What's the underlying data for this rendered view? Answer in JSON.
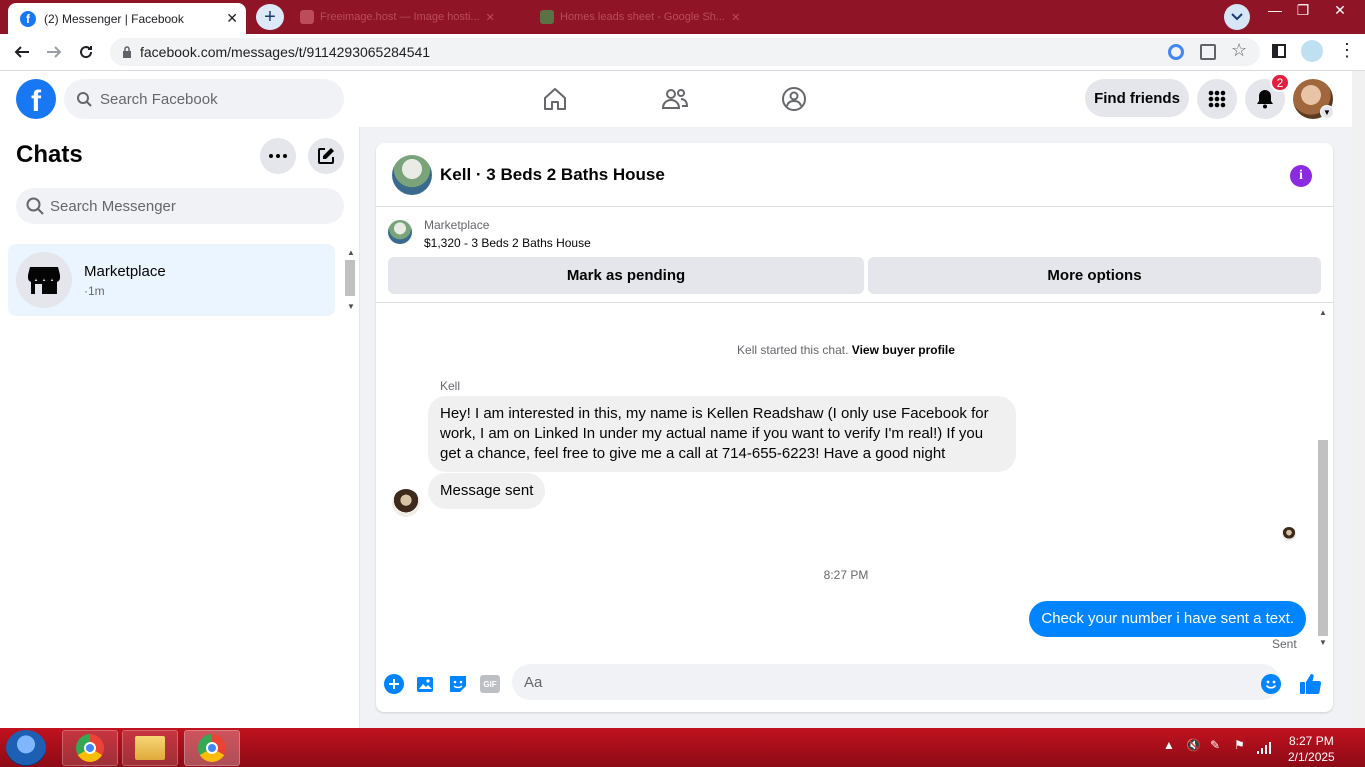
{
  "browser": {
    "active_tab_title": "(2) Messenger | Facebook",
    "inactive_tabs": [
      "Freeimage.host — Image hosti...",
      "Homes leads sheet - Google Sh..."
    ],
    "url": "facebook.com/messages/t/9114293065284541"
  },
  "fb_header": {
    "logo": "f",
    "search_placeholder": "Search Facebook",
    "find_friends": "Find friends",
    "notification_count": "2"
  },
  "chats": {
    "title": "Chats",
    "search_placeholder": "Search Messenger",
    "items": [
      {
        "name": "Marketplace",
        "time": "·1m"
      }
    ]
  },
  "conversation": {
    "title": "Kell · 3 Beds 2 Baths House",
    "info_glyph": "i",
    "marketplace_label": "Marketplace",
    "listing": "$1,320 - 3 Beds 2 Baths House",
    "mark_pending": "Mark as pending",
    "more_options": "More options",
    "system_prefix": "Kell started this chat.",
    "system_link": "View buyer profile",
    "sender_name": "Kell",
    "incoming": [
      "Hey! I am interested in this, my name is Kellen Readshaw (I only use Facebook for work, I am on Linked In under my actual name if you want to verify I'm real!) If you get a chance, feel free to give me a call at 714-655-6223! Have a good night",
      "Message sent"
    ],
    "timestamp": "8:27 PM",
    "outgoing": "Check your number i have sent a text.",
    "sent_status": "Sent",
    "composer_placeholder": "Aa",
    "gif_label": "GIF"
  },
  "taskbar": {
    "time": "8:27 PM",
    "date": "2/1/2025"
  },
  "colors": {
    "fb_blue": "#1877f2",
    "messenger_blue": "#0084ff",
    "taskbar_red": "#c1121f",
    "info_purple": "#8a2be2"
  }
}
